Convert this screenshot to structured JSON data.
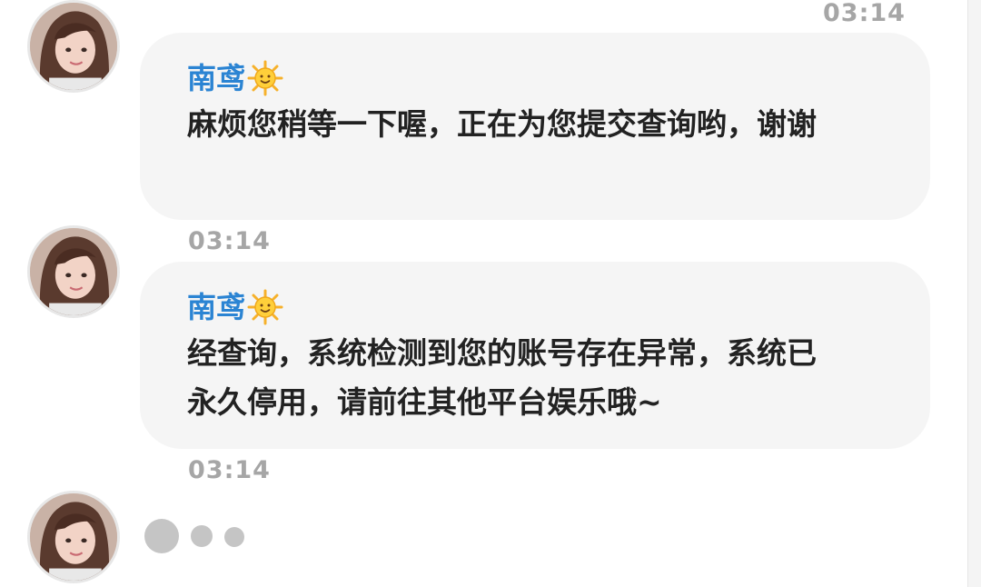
{
  "colors": {
    "accent": "#2b84d3",
    "bubble": "#f5f5f5",
    "timestamp": "#a6a6a6",
    "text": "#222222",
    "typing_dots": "#c5c5c5"
  },
  "messages": [
    {
      "time_above": "03:14",
      "sender": "南鸢",
      "sender_icon": "sun-emoji-icon",
      "avatar_icon": "avatar-icon",
      "text": "麻烦您稍等一下喔，正在为您提交查询哟，谢谢"
    },
    {
      "time_above": "03:14",
      "sender": "南鸢",
      "sender_icon": "sun-emoji-icon",
      "avatar_icon": "avatar-icon",
      "text": "经查询，系统检测到您的账号存在异常，系统已永久停用，请前往其他平台娱乐哦~"
    }
  ],
  "typing": {
    "time_above": "03:14",
    "avatar_icon": "avatar-icon",
    "indicator_icon": "typing-dots-icon"
  }
}
